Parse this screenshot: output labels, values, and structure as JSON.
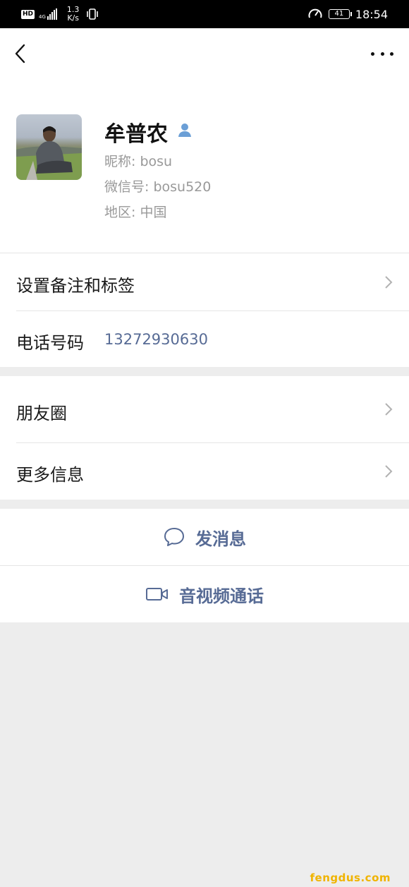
{
  "status_bar": {
    "hd": "HD",
    "network_gen": "4G",
    "speed_value": "1.3",
    "speed_unit": "K/s",
    "battery": "41",
    "time": "18:54"
  },
  "profile": {
    "name": "牟普农",
    "nickname": "昵称: bosu",
    "wechat_id": "微信号: bosu520",
    "region": "地区: 中国"
  },
  "rows": {
    "remark_tags": "设置备注和标签",
    "phone_label": "电话号码",
    "phone_value": "13272930630",
    "moments": "朋友圈",
    "more_info": "更多信息"
  },
  "actions": {
    "send_message": "发消息",
    "av_call": "音视频通话"
  },
  "colors": {
    "link": "#576b95",
    "background": "#ededed",
    "watermark": "#f0b400"
  },
  "watermark": "fengdus.com"
}
